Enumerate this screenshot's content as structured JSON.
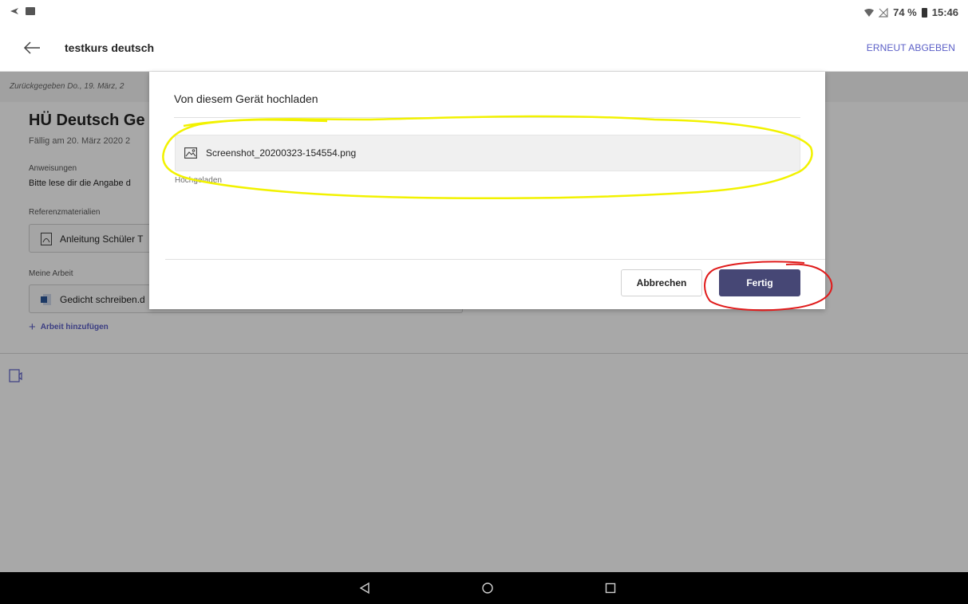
{
  "status_bar": {
    "battery": "74 %",
    "time": "15:46",
    "icons": [
      "send-icon",
      "image-icon",
      "wifi-icon",
      "signal-icon",
      "battery-icon"
    ]
  },
  "app_bar": {
    "title": "testkurs deutsch",
    "action": "ERNEUT ABGEBEN"
  },
  "assignment": {
    "returned": "Zurückgegeben Do., 19. März, 2",
    "title": "HÜ Deutsch Ge",
    "due": "Fällig am 20. März 2020 2",
    "instructions_label": "Anweisungen",
    "instructions_text": "Bitte lese dir die Angabe d",
    "reference_label": "Referenzmaterialien",
    "reference_file": "Anleitung Schüler T",
    "my_work_label": "Meine Arbeit",
    "my_work_file": "Gedicht schreiben.d",
    "add_work": "Arbeit hinzufügen"
  },
  "dialog": {
    "title": "Von diesem Gerät hochladen",
    "file_name": "Screenshot_20200323-154554.png",
    "file_status": "Hochgeladen",
    "cancel_label": "Abbrechen",
    "done_label": "Fertig"
  },
  "colors": {
    "accent": "#5b5fc7",
    "primary_button": "#464775",
    "highlight_yellow": "#f2f200",
    "highlight_red": "#e01b1b"
  }
}
